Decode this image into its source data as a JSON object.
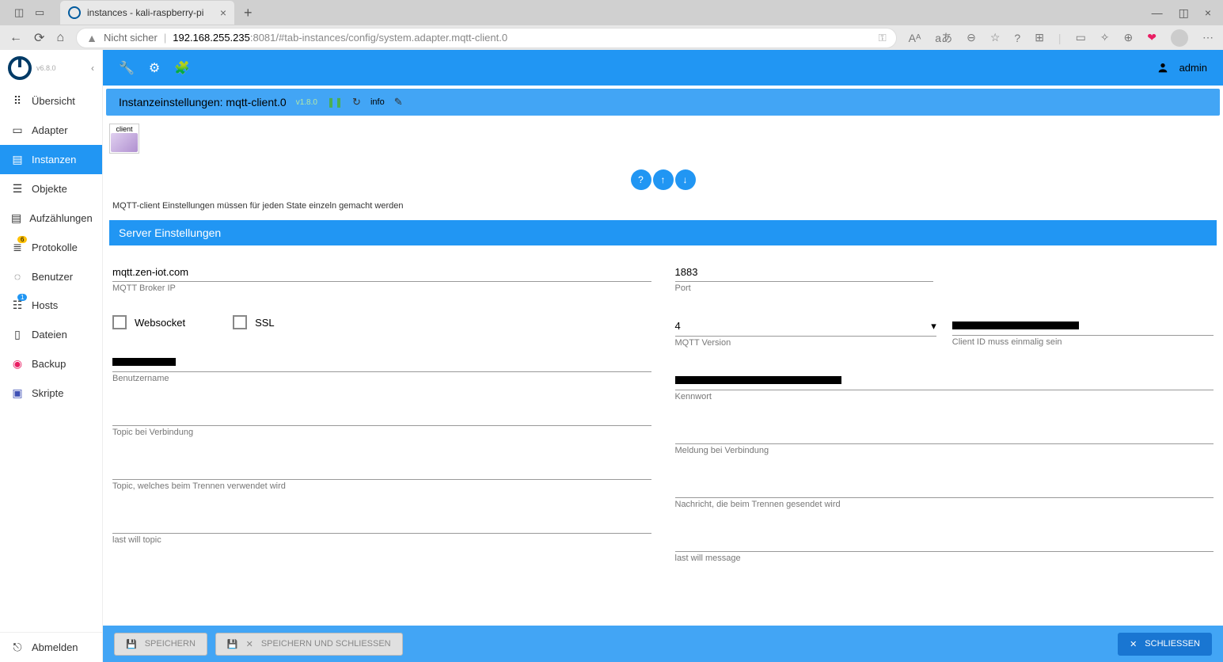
{
  "browser": {
    "tab_title": "instances - kali-raspberry-pi",
    "security": "Nicht sicher",
    "url_host": "192.168.255.235",
    "url_port": ":8081",
    "url_path": "/#tab-instances/config/system.adapter.mqtt-client.0"
  },
  "sidebar": {
    "version": "v6.8.0",
    "items": [
      {
        "label": "Übersicht"
      },
      {
        "label": "Adapter"
      },
      {
        "label": "Instanzen"
      },
      {
        "label": "Objekte"
      },
      {
        "label": "Aufzählungen"
      },
      {
        "label": "Protokolle",
        "badge": "6"
      },
      {
        "label": "Benutzer"
      },
      {
        "label": "Hosts",
        "badge": "1"
      },
      {
        "label": "Dateien"
      },
      {
        "label": "Backup"
      },
      {
        "label": "Skripte"
      }
    ],
    "logout": "Abmelden"
  },
  "topbar": {
    "user": "admin"
  },
  "subheader": {
    "title": "Instanzeinstellungen: mqtt-client.0",
    "version": "v1.8.0",
    "info": "info"
  },
  "content": {
    "client_badge": "client",
    "warning": "MQTT-client Einstellungen müssen für jeden State einzeln gemacht werden",
    "section": "Server Einstellungen",
    "broker_ip": {
      "value": "mqtt.zen-iot.com",
      "label": "MQTT Broker IP"
    },
    "port": {
      "value": "1883",
      "label": "Port"
    },
    "websocket": "Websocket",
    "ssl": "SSL",
    "mqtt_version": {
      "value": "4",
      "label": "MQTT Version"
    },
    "client_id": {
      "label": "Client ID muss einmalig sein"
    },
    "username": {
      "label": "Benutzername"
    },
    "password": {
      "label": "Kennwort"
    },
    "topic_connect": {
      "label": "Topic bei Verbindung"
    },
    "msg_connect": {
      "label": "Meldung bei Verbindung"
    },
    "topic_disconnect": {
      "label": "Topic, welches beim Trennen verwendet wird"
    },
    "msg_disconnect": {
      "label": "Nachricht, die beim Trennen gesendet wird"
    },
    "lwt_topic": {
      "label": "last will topic"
    },
    "lwt_msg": {
      "label": "last will message"
    }
  },
  "footer": {
    "save": "SPEICHERN",
    "save_close": "SPEICHERN UND SCHLIESSEN",
    "close": "SCHLIESSEN"
  }
}
